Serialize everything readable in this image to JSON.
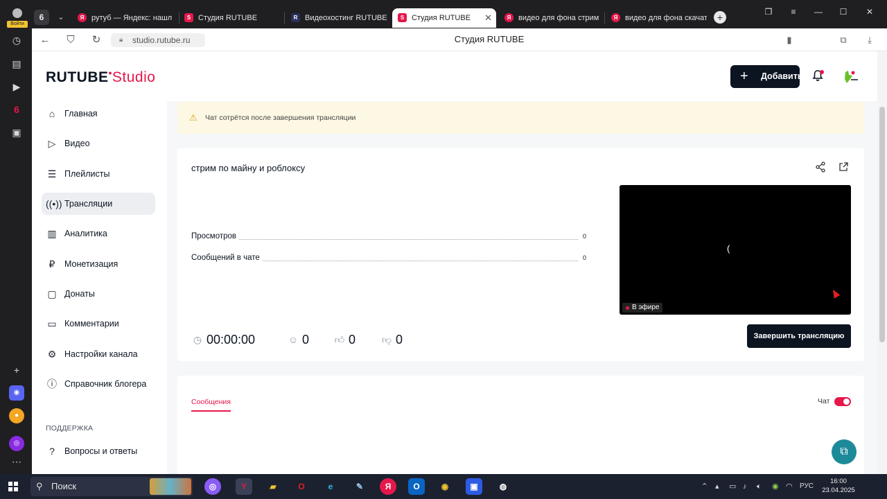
{
  "browser": {
    "profile_label": "Войти",
    "tab_count": "6",
    "tabs": [
      {
        "title": "рутуб — Яндекс: нашл",
        "icon": "yandex-icon"
      },
      {
        "title": "Студия RUTUBE",
        "icon": "rutube-studio-icon"
      },
      {
        "title": "Видеохостинг RUTUBE",
        "icon": "rutube-icon"
      },
      {
        "title": "Студия RUTUBE",
        "icon": "rutube-studio-icon",
        "active": true
      },
      {
        "title": "видео для фона стрим",
        "icon": "yandex-icon"
      },
      {
        "title": "видео для фона скачат",
        "icon": "yandex-icon"
      }
    ],
    "url": "studio.rutube.ru",
    "page_title": "Студия RUTUBE"
  },
  "header": {
    "logo_main": "RUTUBE",
    "logo_sub": "Studio",
    "add_button": "Добавить"
  },
  "sidebar": {
    "items": [
      {
        "label": "Главная",
        "icon": "home-icon"
      },
      {
        "label": "Видео",
        "icon": "video-icon"
      },
      {
        "label": "Плейлисты",
        "icon": "playlist-icon"
      },
      {
        "label": "Трансляции",
        "icon": "broadcast-icon",
        "active": true
      },
      {
        "label": "Аналитика",
        "icon": "analytics-icon"
      },
      {
        "label": "Монетизация",
        "icon": "ruble-icon"
      },
      {
        "label": "Донаты",
        "icon": "donate-icon"
      },
      {
        "label": "Комментарии",
        "icon": "comments-icon"
      },
      {
        "label": "Настройки канала",
        "icon": "gear-icon"
      },
      {
        "label": "Справочник блогера",
        "icon": "info-icon"
      }
    ],
    "support_heading": "ПОДДЕРЖКА",
    "faq_item": "Вопросы и ответы"
  },
  "notice": {
    "text": "Чат сотрётся после завершения трансляции"
  },
  "stream": {
    "title": "стрим по майну и роблоксу",
    "stats": [
      {
        "label": "Просмотров",
        "value": "0"
      },
      {
        "label": "Сообщений в чате",
        "value": "0"
      }
    ],
    "live_badge": "В эфире",
    "player_glyph": "(",
    "end_button": "Завершить трансляцию",
    "duration": "00:00:00",
    "viewers": "0",
    "likes": "0",
    "dislikes": "0"
  },
  "chat_panel": {
    "tab_messages": "Сообщения",
    "chat_label": "Чат",
    "chat_enabled": true
  },
  "taskbar": {
    "search_placeholder": "Поиск",
    "language": "РУС",
    "time": "16:00",
    "date": "23.04.2025"
  },
  "colors": {
    "accent": "#e5174b",
    "dark": "#0c1421",
    "notice_bg": "#fdf8e3"
  }
}
